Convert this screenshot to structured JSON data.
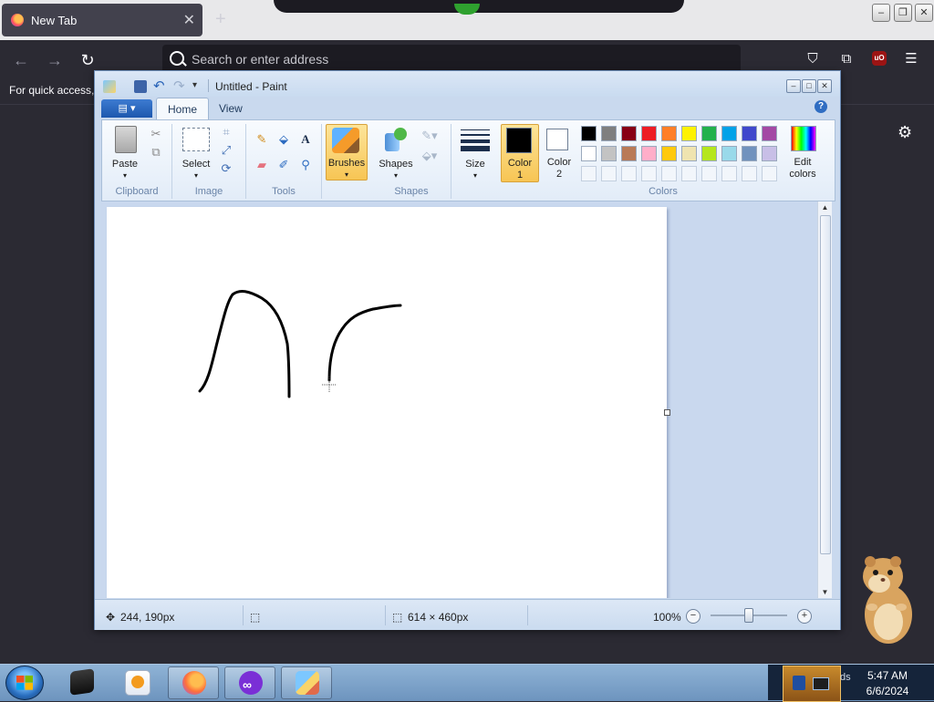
{
  "browser": {
    "tab_title": "New Tab",
    "tab_close": "✕",
    "new_tab": "+",
    "url_placeholder": "Search or enter address",
    "bookmarks_text": "For quick access,",
    "ublock_label": "uO",
    "icons": [
      "back-arrow-icon",
      "forward-arrow-icon",
      "reload-icon",
      "search-icon",
      "pocket-icon",
      "extensions-icon",
      "ublock-icon",
      "menu-icon",
      "settings-gear-icon"
    ]
  },
  "paint": {
    "title": "Untitled - Paint",
    "tabs": [
      {
        "label": "Home",
        "active": true
      },
      {
        "label": "View",
        "active": false
      }
    ],
    "groups": {
      "clipboard": {
        "label": "Clipboard",
        "paste": "Paste"
      },
      "image": {
        "label": "Image",
        "select": "Select"
      },
      "tools": {
        "label": "Tools"
      },
      "brushes": {
        "label": "Brushes"
      },
      "shapes": {
        "label": "Shapes",
        "shapes_btn": "Shapes"
      },
      "size": {
        "label": "Size"
      },
      "colors": {
        "label": "Colors",
        "color1": "Color",
        "color1_num": "1",
        "color2": "Color",
        "color2_num": "2",
        "edit1": "Edit",
        "edit2": "colors"
      }
    },
    "palette_row1": [
      "#000000",
      "#7f7f7f",
      "#880015",
      "#ed1c24",
      "#ff7f27",
      "#fff200",
      "#22b14c",
      "#00a2e8",
      "#3f48cc",
      "#a349a4"
    ],
    "palette_row2": [
      "#ffffff",
      "#c3c3c3",
      "#b97a57",
      "#ffaec9",
      "#ffc90e",
      "#efe4b0",
      "#b5e61d",
      "#99d9ea",
      "#7092be",
      "#c8bfe7"
    ],
    "color1_value": "#000000",
    "color2_value": "#ffffff",
    "status": {
      "cursor_pos": "244, 190px",
      "canvas_size": "614 × 460px",
      "zoom": "100%"
    }
  },
  "taskbar": {
    "time": "5:47 AM",
    "date": "6/6/2024",
    "tray_text": "ds"
  }
}
